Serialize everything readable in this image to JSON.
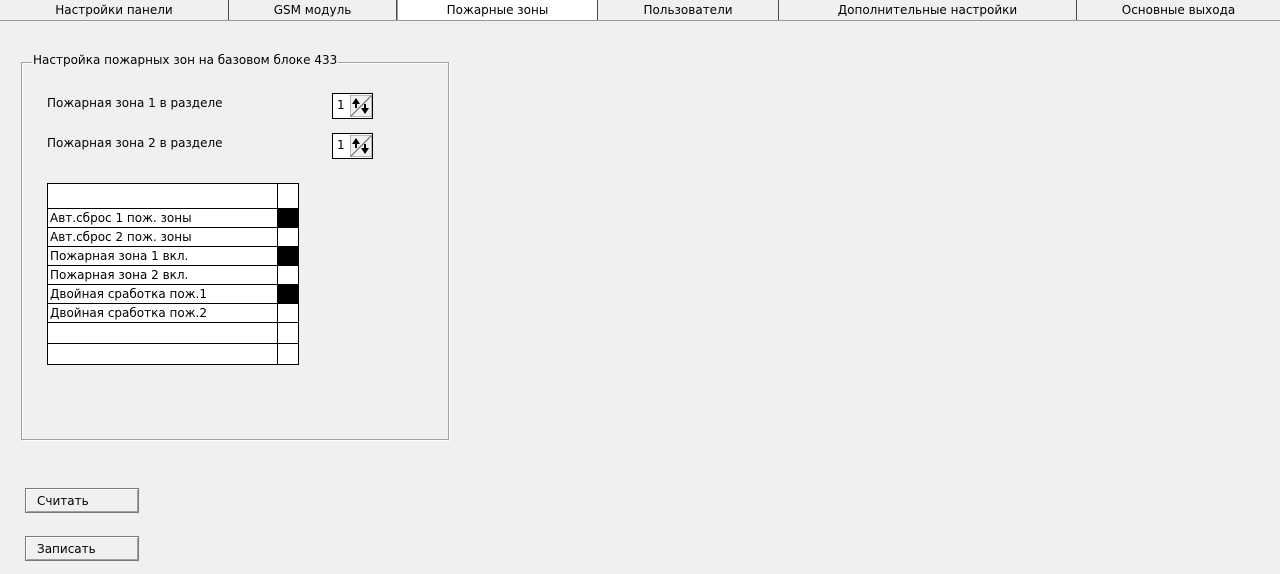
{
  "tabs": [
    {
      "label": "Настройки панели",
      "active": false
    },
    {
      "label": "GSM модуль",
      "active": false
    },
    {
      "label": "Пожарные зоны",
      "active": true
    },
    {
      "label": "Пользователи",
      "active": false
    },
    {
      "label": "Дополнительные настройки",
      "active": false
    },
    {
      "label": "Основные выхода",
      "active": false
    }
  ],
  "group": {
    "title": "Настройка пожарных зон на базовом блоке 433"
  },
  "fields": [
    {
      "label": "Пожарная зона 1 в разделе",
      "value": "1"
    },
    {
      "label": "Пожарная зона 2 в разделе",
      "value": "1"
    }
  ],
  "grid": {
    "rows": [
      {
        "label": "Авт.сброс 1 пож. зоны",
        "checked": true
      },
      {
        "label": "Авт.сброс 2 пож. зоны",
        "checked": false
      },
      {
        "label": "Пожарная зона 1 вкл.",
        "checked": true
      },
      {
        "label": "Пожарная зона 2 вкл.",
        "checked": false
      },
      {
        "label": "Двойная сработка пож.1",
        "checked": true
      },
      {
        "label": "Двойная сработка пож.2",
        "checked": false
      }
    ]
  },
  "buttons": {
    "read_label": "Считать",
    "write_label": "Записать"
  },
  "colors": {
    "background": "#f0f0f0",
    "active_tab": "#ffffff",
    "checked_cell": "#000000"
  }
}
